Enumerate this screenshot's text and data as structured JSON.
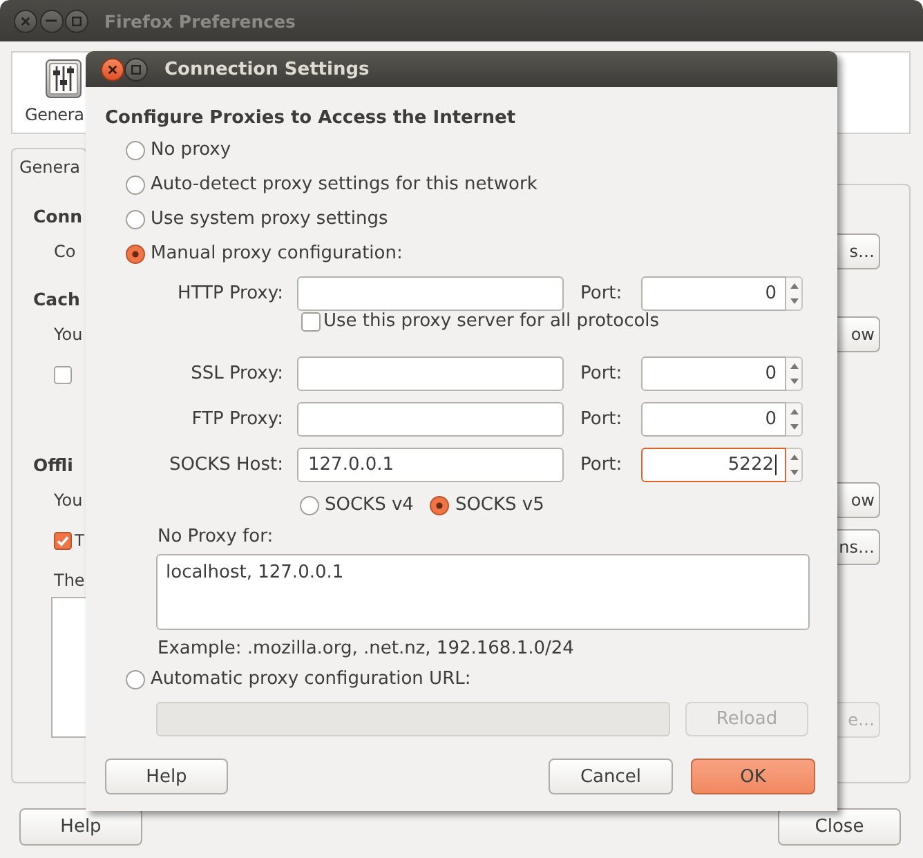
{
  "window": {
    "title": "Firefox Preferences"
  },
  "toolbar": {
    "items": [
      {
        "label": "Genera"
      }
    ]
  },
  "tabs": [
    {
      "label": "Genera",
      "selected": true
    }
  ],
  "panel": {
    "sections": [
      {
        "heading": "Conn",
        "rows": [
          {
            "kind": "text",
            "text": "Co",
            "button": {
              "label": "s…",
              "disabled": false
            }
          }
        ]
      },
      {
        "heading": "Cach",
        "rows": [
          {
            "kind": "text",
            "text": "You",
            "button": {
              "label": "ow",
              "disabled": false
            }
          },
          {
            "kind": "checkbox",
            "checked": false
          }
        ]
      },
      {
        "heading": "Offli",
        "rows": [
          {
            "kind": "text",
            "text": "You",
            "button": {
              "label": "ow",
              "disabled": false
            }
          },
          {
            "kind": "checkbox",
            "checked": true,
            "label": "T",
            "button": {
              "label": "ns…",
              "disabled": false
            }
          },
          {
            "kind": "text",
            "text": "The"
          },
          {
            "kind": "list",
            "button": {
              "label": "e…",
              "disabled": true
            }
          }
        ]
      }
    ]
  },
  "dialog": {
    "title": "Connection Settings",
    "heading": "Configure Proxies to Access the Internet",
    "proxy_modes": [
      {
        "label": "No proxy",
        "selected": false
      },
      {
        "label": "Auto-detect proxy settings for this network",
        "selected": false
      },
      {
        "label": "Use system proxy settings",
        "selected": false
      },
      {
        "label": "Manual proxy configuration:",
        "selected": true
      }
    ],
    "manual_settings": [
      {
        "kind": "proxy",
        "label": "HTTP Proxy:",
        "port_label": "Port:",
        "port": "0",
        "focused": false
      },
      {
        "kind": "checkbox",
        "label": "Use this proxy server for all protocols",
        "checked": false
      },
      {
        "kind": "proxy",
        "label": "SSL Proxy:",
        "port_label": "Port:",
        "port": "0",
        "focused": false
      },
      {
        "kind": "proxy",
        "label": "FTP Proxy:",
        "port_label": "Port:",
        "port": "0",
        "focused": false
      },
      {
        "kind": "proxy",
        "label": "SOCKS Host:",
        "value": "127.0.0.1",
        "port_label": "Port:",
        "port": "5222",
        "focused": true
      },
      {
        "kind": "radios",
        "options": [
          {
            "label": "SOCKS v4",
            "selected": false
          },
          {
            "label": "SOCKS v5",
            "selected": true
          }
        ]
      }
    ],
    "no_proxy": {
      "label": "No Proxy for:",
      "value": "localhost, 127.0.0.1",
      "example": "Example: .mozilla.org, .net.nz, 192.168.1.0/24"
    },
    "auto_config": {
      "label": "Automatic proxy configuration URL:",
      "selected": false,
      "url_disabled": true,
      "reload": {
        "label": "Reload",
        "disabled": true
      }
    },
    "buttons": [
      {
        "label": "Help",
        "default": false
      },
      {
        "label": "Cancel",
        "default": false
      },
      {
        "label": "OK",
        "default": true
      }
    ]
  },
  "footer": {
    "buttons": [
      {
        "label": "Help"
      },
      {
        "label": "Close"
      }
    ]
  }
}
